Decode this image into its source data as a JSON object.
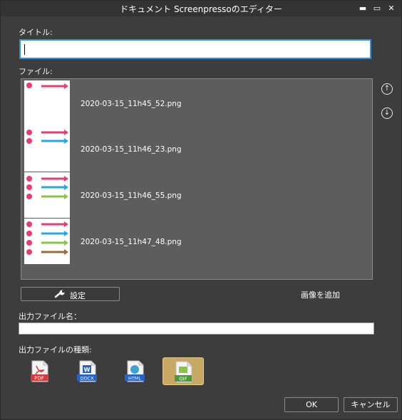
{
  "window": {
    "title": "ドキュメント Screenpressoのエディター",
    "controls": {
      "minimize": "▬",
      "maximize": "▭",
      "close": "✕"
    }
  },
  "title_field": {
    "label": "タイトル:",
    "value": ""
  },
  "files": {
    "label": "ファイル:",
    "items": [
      {
        "name": "2020-03-15_11h45_52.png"
      },
      {
        "name": "2020-03-15_11h46_23.png"
      },
      {
        "name": "2020-03-15_11h46_55.png"
      },
      {
        "name": "2020-03-15_11h47_48.png"
      }
    ],
    "move_up_icon": "arrow-up-circle-icon",
    "move_down_icon": "arrow-down-circle-icon"
  },
  "settings_button": {
    "label": "設定",
    "icon": "wrench-icon"
  },
  "add_image_link": "画像を追加",
  "output_name": {
    "label": "出力ファイル名：",
    "value": ""
  },
  "output_type": {
    "label": "出力ファイルの種類:",
    "formats": [
      {
        "id": "pdf",
        "badge": "PDF",
        "color": "#d63b3b"
      },
      {
        "id": "docx",
        "badge": "DOCX",
        "color": "#2b63c2"
      },
      {
        "id": "html",
        "badge": "HTML",
        "color": "#2b63c2"
      },
      {
        "id": "gif",
        "badge": "GIF",
        "color": "#4a9a3a"
      }
    ],
    "selected": "gif"
  },
  "buttons": {
    "ok": "OK",
    "cancel": "キャンセル"
  },
  "colors": {
    "pink": "#e83e6c",
    "blue": "#29a8e0",
    "green": "#8bc34a",
    "brown": "#a0683a",
    "selected_bg": "#c7a964",
    "focus": "#2f8fe0"
  }
}
